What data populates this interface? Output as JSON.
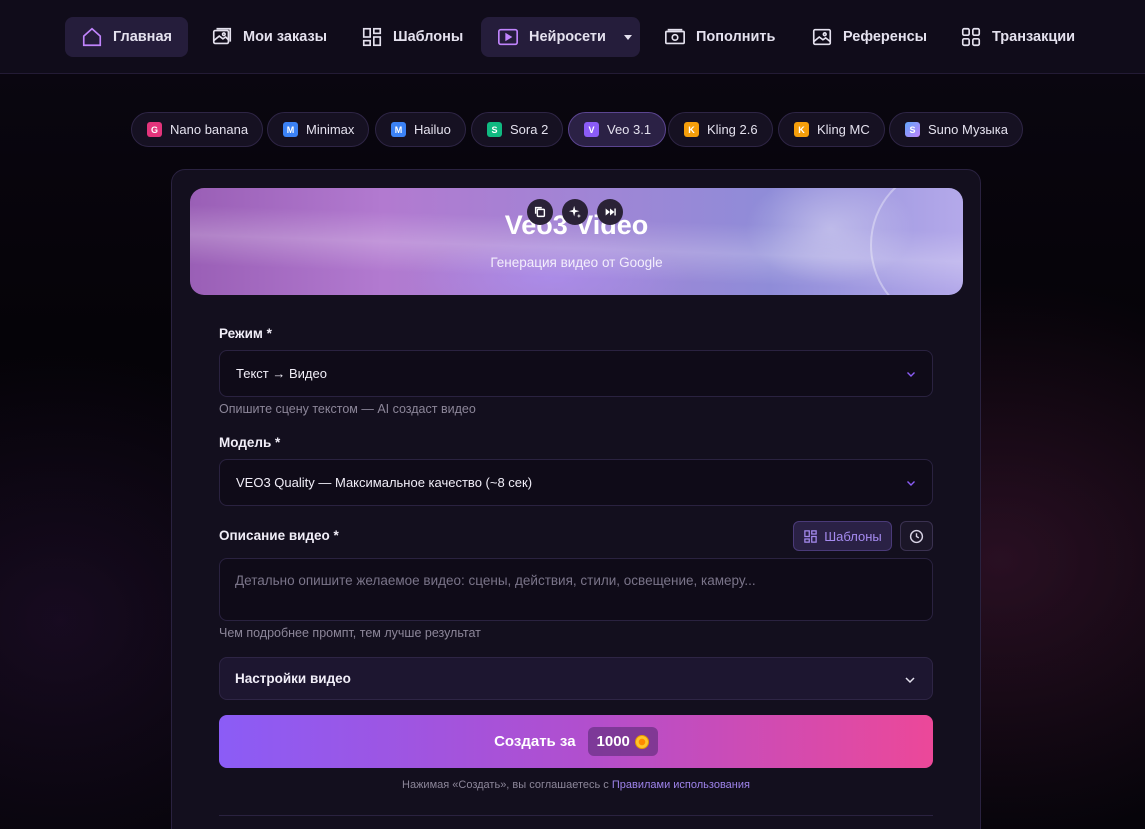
{
  "nav": {
    "items": [
      {
        "label": "Главная",
        "icon": "home-icon"
      },
      {
        "label": "Мои заказы",
        "icon": "image-icon"
      },
      {
        "label": "Шаблоны",
        "icon": "grid-icon"
      },
      {
        "label": "Нейросети",
        "icon": "play-icon"
      },
      {
        "label": "Пополнить",
        "icon": "money-icon"
      },
      {
        "label": "Референсы",
        "icon": "picture-icon"
      },
      {
        "label": "Транзакции",
        "icon": "grid-icon"
      }
    ]
  },
  "models": [
    {
      "letter": "G",
      "label": "Nano banana",
      "color": "#e3347b"
    },
    {
      "letter": "M",
      "label": "Minimax",
      "color": "#3b82f6"
    },
    {
      "letter": "M",
      "label": "Hailuo",
      "color": "#3b82f6"
    },
    {
      "letter": "S",
      "label": "Sora 2",
      "color": "#10b981"
    },
    {
      "letter": "V",
      "label": "Veo 3.1",
      "color": "#8b5cf6"
    },
    {
      "letter": "K",
      "label": "Kling 2.6",
      "color": "#f59e0b"
    },
    {
      "letter": "K",
      "label": "Kling MC",
      "color": "#f59e0b"
    },
    {
      "letter": "S",
      "label": "Suno Музыка",
      "color": "#a78bfa"
    }
  ],
  "hero": {
    "title": "Veo3 Video",
    "subtitle": "Генерация видео от Google"
  },
  "form": {
    "mode_label": "Режим *",
    "mode_value": "Текст → Видео",
    "mode_hint": "Опишите сцену текстом — AI создаст видео",
    "model_label": "Модель *",
    "model_value": "VEO3 Quality — Максимальное качество (~8 сек)",
    "desc_label": "Описание видео *",
    "templates_button": "Шаблоны",
    "desc_placeholder": "Детально опишите желаемое видео: сцены, действия, стили, освещение, камеру...",
    "desc_hint": "Чем подробнее промпт, тем лучше результат",
    "settings_label": "Настройки видео",
    "create_label": "Создать за",
    "price": "1000",
    "terms_text": "Нажимая «Создать», вы соглашаетесь с",
    "terms_link": "Правилами использования"
  },
  "colors": {
    "accent": "#8b5cf6",
    "accent_pink": "#ec4899",
    "background": "#07050b"
  }
}
